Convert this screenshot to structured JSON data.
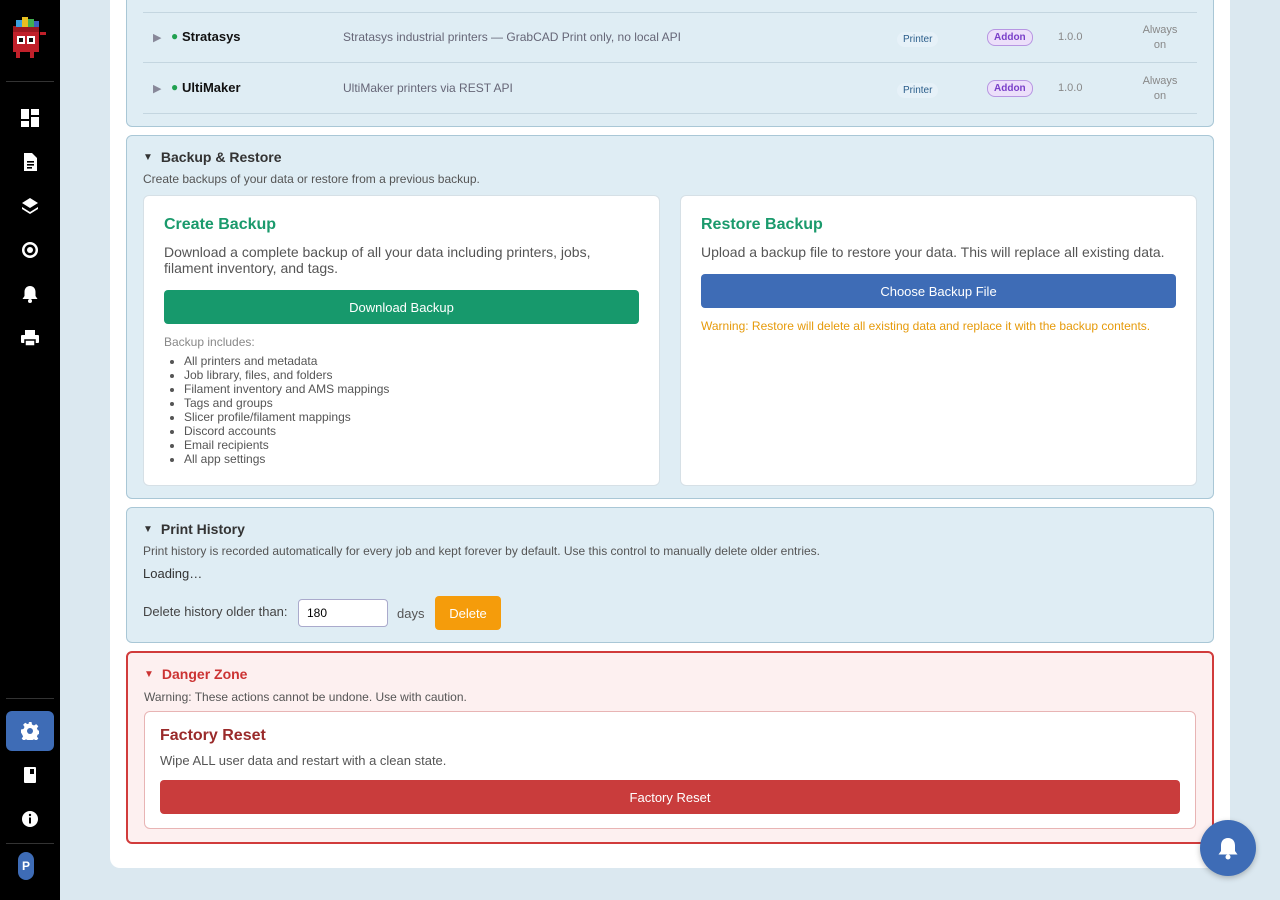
{
  "sidebar": {
    "avatar_initial": "P",
    "nav_icons": [
      "dashboard-icon",
      "document-icon",
      "layers-icon",
      "target-icon",
      "bell-icon",
      "printer-icon",
      "settings-icon",
      "book-icon",
      "info-icon"
    ]
  },
  "addons": [
    {
      "name": "Stratasys",
      "description": "Stratasys industrial printers — GrabCAD Print only, no local API",
      "type": "Printer",
      "badge": "Addon",
      "version": "1.0.0",
      "state_line1": "Always",
      "state_line2": "on"
    },
    {
      "name": "UltiMaker",
      "description": "UltiMaker printers via REST API",
      "type": "Printer",
      "badge": "Addon",
      "version": "1.0.0",
      "state_line1": "Always",
      "state_line2": "on"
    }
  ],
  "backup": {
    "title": "Backup & Restore",
    "description": "Create backups of your data or restore from a previous backup.",
    "create": {
      "title": "Create Backup",
      "text": "Download a complete backup of all your data including printers, jobs, filament inventory, and tags.",
      "button": "Download Backup",
      "includes_heading": "Backup includes:",
      "includes": [
        "All printers and metadata",
        "Job library, files, and folders",
        "Filament inventory and AMS mappings",
        "Tags and groups",
        "Slicer profile/filament mappings",
        "Discord accounts",
        "Email recipients",
        "All app settings"
      ]
    },
    "restore": {
      "title": "Restore Backup",
      "text": "Upload a backup file to restore your data. This will replace all existing data.",
      "button": "Choose Backup File",
      "warning": "Warning: Restore will delete all existing data and replace it with the backup contents."
    }
  },
  "history": {
    "title": "Print History",
    "description": "Print history is recorded automatically for every job and kept forever by default. Use this control to manually delete older entries.",
    "loading": "Loading…",
    "label": "Delete history older than:",
    "days_value": "180",
    "days_unit": "days",
    "button": "Delete"
  },
  "danger": {
    "title": "Danger Zone",
    "warning": "Warning: These actions cannot be undone. Use with caution.",
    "reset_title": "Factory Reset",
    "reset_text": "Wipe ALL user data and restart with a clean state.",
    "reset_button": "Factory Reset"
  },
  "colors": {
    "accent": "#3e6cb6",
    "success": "#17996c",
    "warning": "#f59c0b",
    "danger": "#c93c3c",
    "addon_badge": "#7a3fc9"
  }
}
